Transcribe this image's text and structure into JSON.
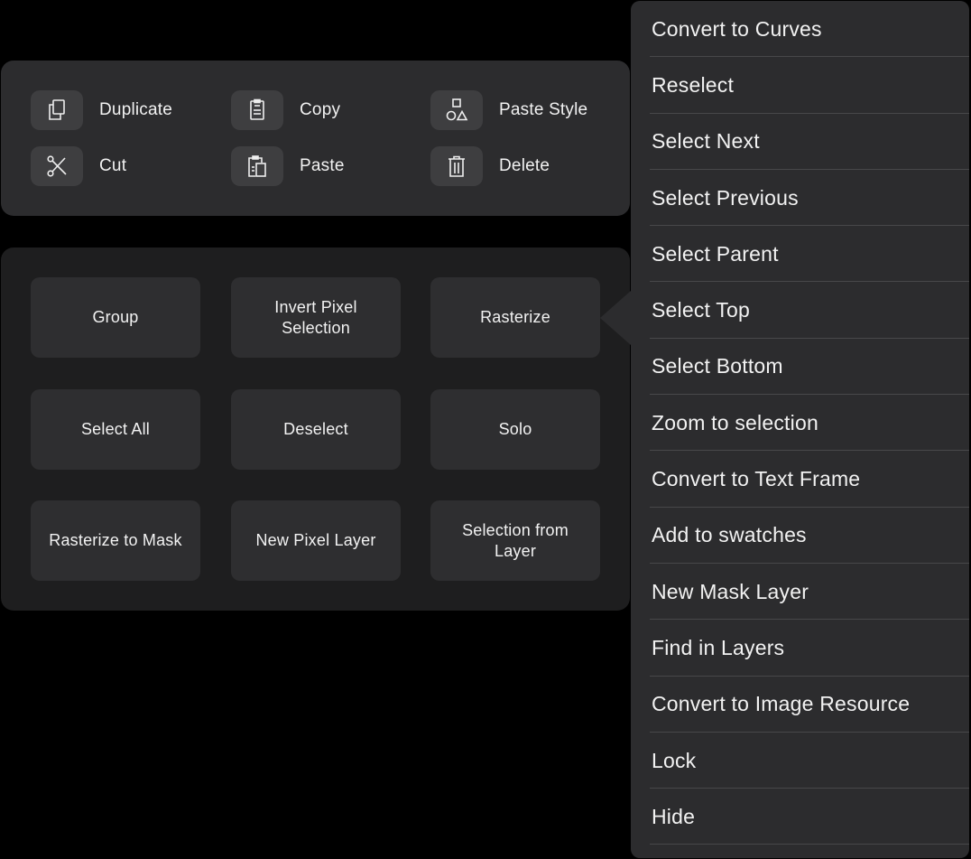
{
  "quick_actions": [
    {
      "id": "duplicate",
      "label": "Duplicate",
      "icon": "duplicate-icon"
    },
    {
      "id": "copy",
      "label": "Copy",
      "icon": "clipboard-icon"
    },
    {
      "id": "paste-style",
      "label": "Paste Style",
      "icon": "shapes-icon"
    },
    {
      "id": "cut",
      "label": "Cut",
      "icon": "scissors-icon"
    },
    {
      "id": "paste",
      "label": "Paste",
      "icon": "paste-icon"
    },
    {
      "id": "delete",
      "label": "Delete",
      "icon": "trash-icon"
    }
  ],
  "grid_buttons": [
    {
      "id": "group",
      "label": "Group"
    },
    {
      "id": "invert-pixel-selection",
      "label": "Invert Pixel Selection"
    },
    {
      "id": "rasterize",
      "label": "Rasterize"
    },
    {
      "id": "select-all",
      "label": "Select All"
    },
    {
      "id": "deselect",
      "label": "Deselect"
    },
    {
      "id": "solo",
      "label": "Solo"
    },
    {
      "id": "rasterize-to-mask",
      "label": "Rasterize to Mask"
    },
    {
      "id": "new-pixel-layer",
      "label": "New Pixel Layer"
    },
    {
      "id": "selection-from-layer",
      "label": "Selection from Layer"
    }
  ],
  "submenu": {
    "items": [
      "Convert to Curves",
      "Reselect",
      "Select Next",
      "Select Previous",
      "Select Parent",
      "Select Top",
      "Select Bottom",
      "Zoom to selection",
      "Convert to Text Frame",
      "Add to swatches",
      "New Mask Layer",
      "Find in Layers",
      "Convert to Image Resource",
      "Lock",
      "Hide"
    ]
  },
  "colors": {
    "background": "#000000",
    "panel": "#2c2c2e",
    "panel_dark": "#1e1e1f",
    "tile": "#3e3e40",
    "text": "#f2f2f2",
    "separator": "#48484a"
  }
}
